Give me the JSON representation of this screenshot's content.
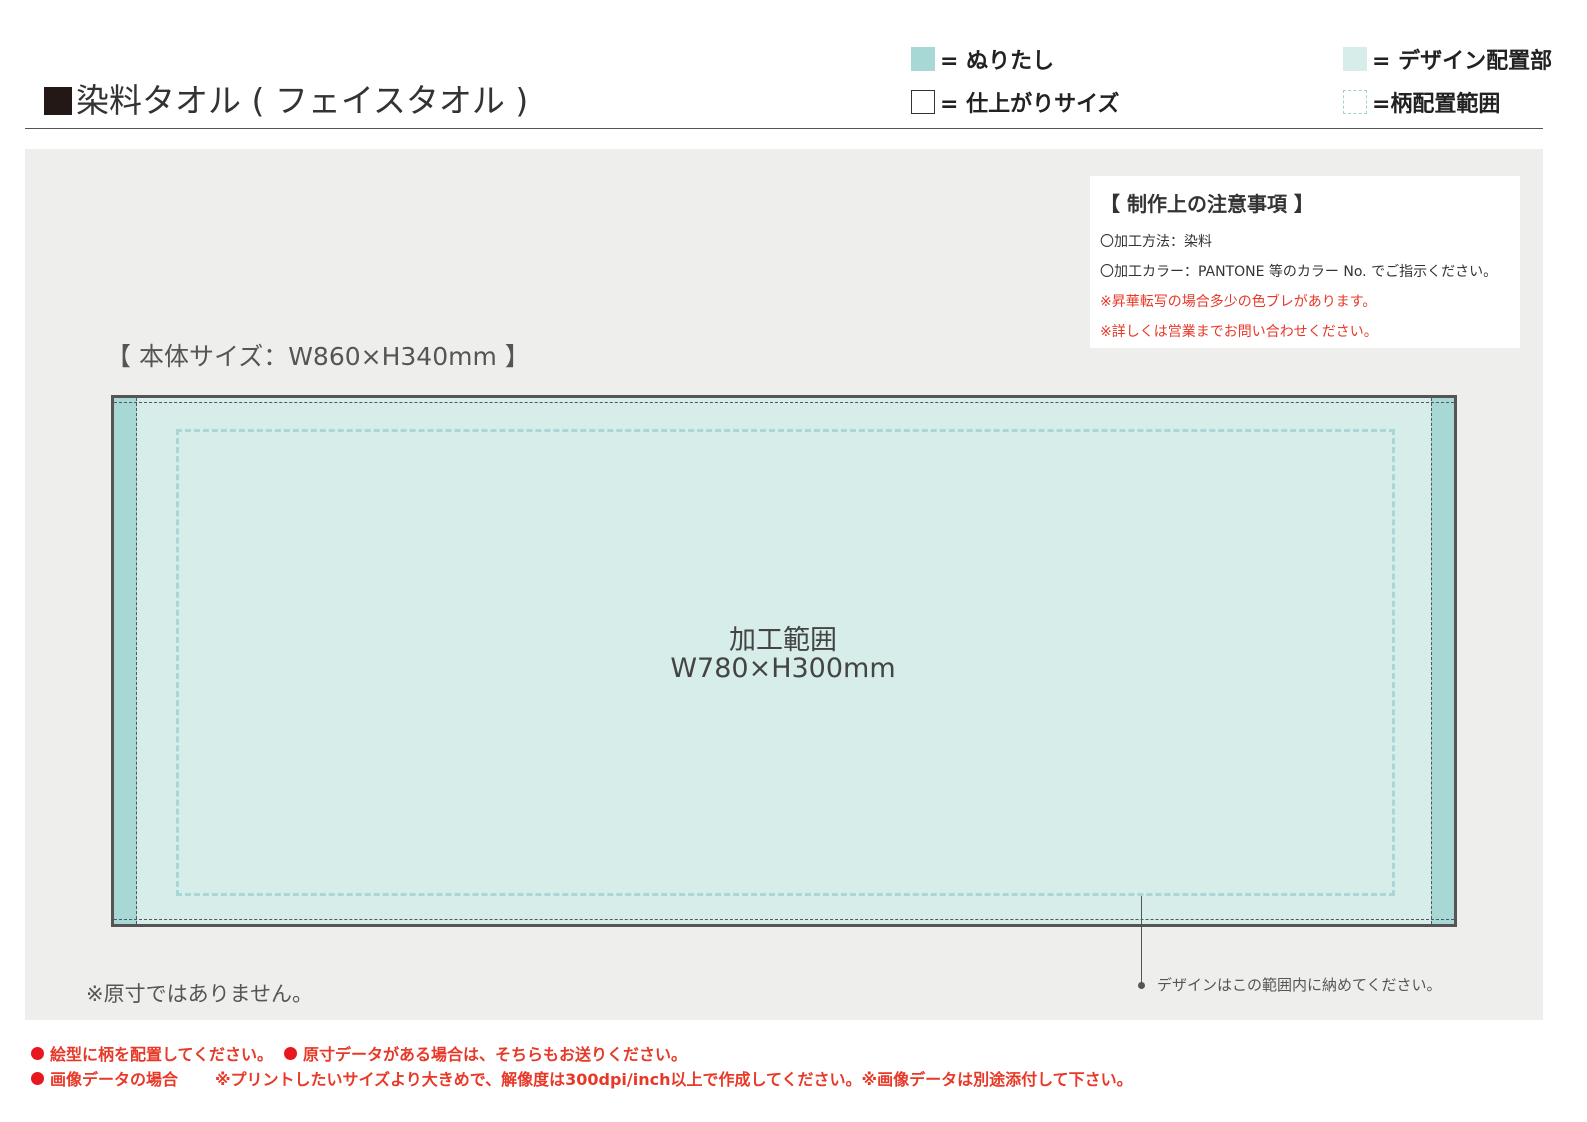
{
  "header": {
    "title": "染料タオル ( フェイスタオル )"
  },
  "legend": {
    "bleed": "= ぬりたし",
    "trim": "= 仕上がりサイズ",
    "design": "= デザイン配置部",
    "pattern": "=柄配置範囲"
  },
  "notes": {
    "title": "【 制作上の注意事項 】",
    "lines": [
      "〇加工方法：染料",
      "〇加工カラー：PANTONE 等のカラー No. でご指示ください。",
      "※昇華転写の場合多少の色ブレがあります。",
      "※詳しくは営業までお問い合わせください。"
    ]
  },
  "body_size": "【 本体サイズ：W860×H340mm 】",
  "processing_area": {
    "label": "加工範囲",
    "size": "W780×H300mm"
  },
  "leader_note": "デザインはこの範囲内に納めてください。",
  "not_actual_size": "※原寸ではありません。",
  "footer": {
    "line1_a": "絵型に柄を配置してください。",
    "line1_b": "原寸データがある場合は、そちらもお送りください。",
    "line2_a": "画像データの場合",
    "line2_b": "※プリントしたいサイズより大きめで、解像度は300dpi/inch以上で作成してください。※画像データは別途添付して下さい。"
  },
  "colors": {
    "bleed": "#a8d8d6",
    "design": "#d6ede9",
    "canvas": "#eeefed",
    "warning_red": "#e83828"
  }
}
